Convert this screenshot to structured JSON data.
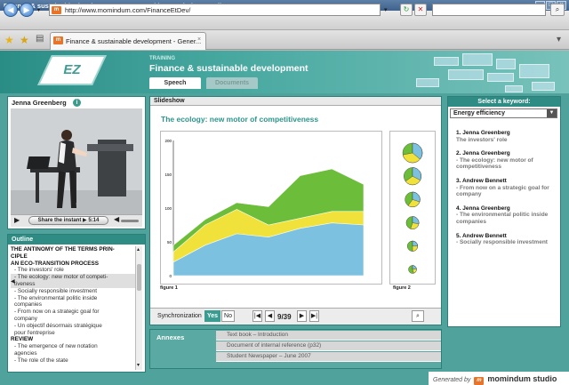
{
  "window": {
    "title": "Finance & sustainable development - Generated by Momindum Studio",
    "url": "http://www.momindum.com/FinanceEtDev/",
    "tab_label": "Finance & sustainable development - Gener..."
  },
  "header": {
    "logo_text": "EZ",
    "kicker": "TRAINING",
    "course_title": "Finance & sustainable development",
    "tabs": [
      {
        "label": "Speech",
        "active": true
      },
      {
        "label": "Documents",
        "active": false
      }
    ]
  },
  "speaker": {
    "name": "Jenna Greenberg",
    "share_label": "Share the instant",
    "time": "5:14"
  },
  "outline": {
    "title": "Outline",
    "items": [
      {
        "text": "THE ANTINOMY OF THE TERMS PRIN-",
        "kind": "h"
      },
      {
        "text": "CIPLE",
        "kind": "h"
      },
      {
        "text": "AN ECO-TRANSITION PROCESS",
        "kind": "h"
      },
      {
        "text": "- The investors' role",
        "kind": "s"
      },
      {
        "text": "- The ecology: new motor of competi-",
        "kind": "a"
      },
      {
        "text": "tiveness",
        "kind": "a"
      },
      {
        "text": "- Socially responsible investment",
        "kind": "s"
      },
      {
        "text": "- The environmental politic inside",
        "kind": "s"
      },
      {
        "text": "companies",
        "kind": "s"
      },
      {
        "text": "- From now on a strategic goal for",
        "kind": "s"
      },
      {
        "text": "company",
        "kind": "s"
      },
      {
        "text": "- Un objectif désormais stratégique",
        "kind": "s"
      },
      {
        "text": "pour l'entreprise",
        "kind": "s"
      },
      {
        "text": "REVIEW",
        "kind": "h"
      },
      {
        "text": "- The emergence of new notation",
        "kind": "s"
      },
      {
        "text": "agencies",
        "kind": "s"
      },
      {
        "text": "- The role of the state",
        "kind": "s"
      }
    ]
  },
  "slideshow": {
    "header": "Slideshow",
    "title": "The ecology: new motor of competitiveness",
    "fig1_label": "figure 1",
    "fig2_label": "figure 2",
    "sync_label": "Synchronization",
    "yes_label": "Yes",
    "no_label": "No",
    "page_indicator": "9/39"
  },
  "chart_data": {
    "type": "area",
    "x": [
      1,
      2,
      3,
      4,
      5,
      6,
      7
    ],
    "ylim": [
      0,
      200
    ],
    "yticks": [
      "200",
      "150",
      "100",
      "50",
      "0"
    ],
    "series": [
      {
        "values": [
          20,
          45,
          62,
          57,
          70,
          78,
          75
        ],
        "color": "#7cc2e0"
      },
      {
        "values": [
          35,
          75,
          98,
          75,
          85,
          95,
          95
        ],
        "color": "#f0e23a"
      },
      {
        "values": [
          45,
          83,
          108,
          102,
          148,
          158,
          135
        ],
        "color": "#6bbd3a"
      }
    ],
    "pies": [
      0.72,
      0.65,
      0.6,
      0.55,
      0.5,
      0.45
    ]
  },
  "annexes": {
    "title": "Annexes",
    "items": [
      "Text book – Introduction",
      "Document of internal reference (p32)",
      "Student Newspaper – June 2007"
    ]
  },
  "keywords": {
    "title": "Select a keyword:",
    "selected": "Energy efficiency",
    "items": [
      {
        "name": "1. Jenna Greenberg",
        "desc": "The investors' role"
      },
      {
        "name": "2. Jenna Greenberg",
        "desc": "- The ecology: new motor of competitiveness"
      },
      {
        "name": "3. Andrew Bennett",
        "desc": "- From now on a strategic goal for company"
      },
      {
        "name": "4. Jenna Greenberg",
        "desc": "- The environmental politic inside companies"
      },
      {
        "name": "5. Andrew Bennett",
        "desc": "- Socially responsible investment"
      }
    ]
  },
  "footer": {
    "generated_by": "Generated by",
    "brand": "momindum studio"
  },
  "colors": {
    "accent": "#2f8c84",
    "background": "#4fa39c",
    "title_teal": "#2a958c"
  }
}
